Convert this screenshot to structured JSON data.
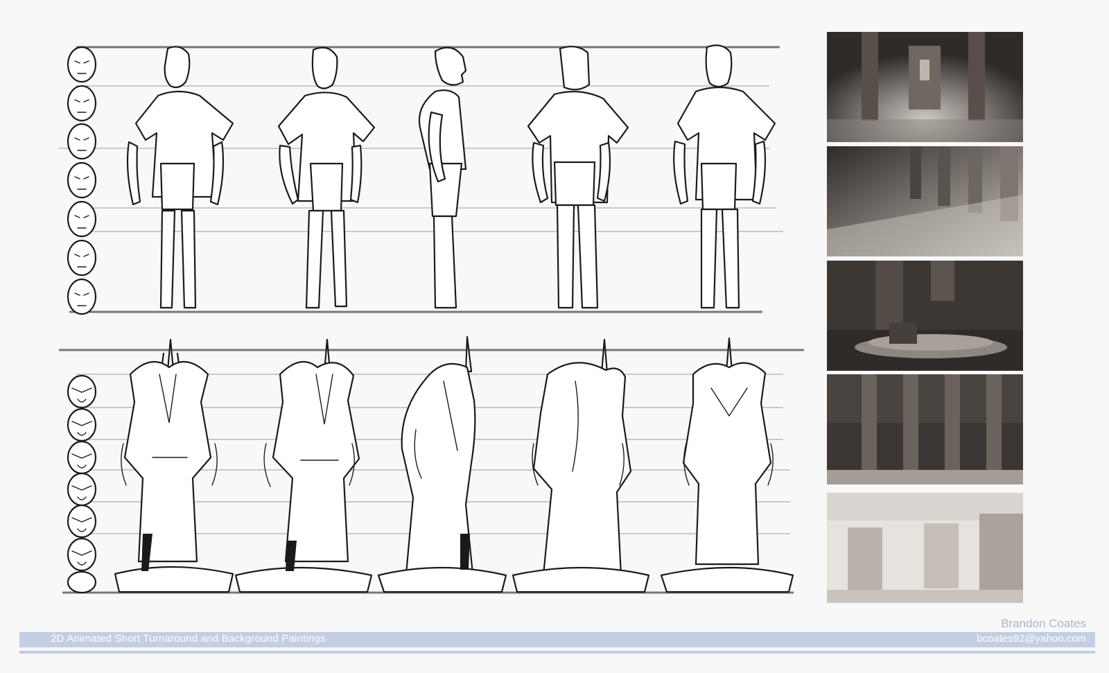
{
  "artist": {
    "name": "Brandon Coates",
    "email": "bcoates92@yahoo.com"
  },
  "caption": "2D Animated Short Turnaround and Background Paintings",
  "sheets": {
    "king_turnaround": {
      "views": [
        "front",
        "three-quarter front",
        "side",
        "three-quarter back",
        "back"
      ],
      "head_units": 7
    },
    "wizard_turnaround": {
      "views": [
        "front",
        "three-quarter front",
        "side",
        "three-quarter back",
        "back"
      ],
      "head_units": 6
    }
  },
  "background_paintings": [
    {
      "id": "throne-hall-wide"
    },
    {
      "id": "pillared-hall"
    },
    {
      "id": "throne-dais"
    },
    {
      "id": "colonnade"
    },
    {
      "id": "office-interior"
    }
  ],
  "colors": {
    "accent_band": "#c3cde3",
    "artist_name": "#a9b4cd",
    "ink": "#1a1a1a",
    "paper": "#f8f8f8"
  }
}
